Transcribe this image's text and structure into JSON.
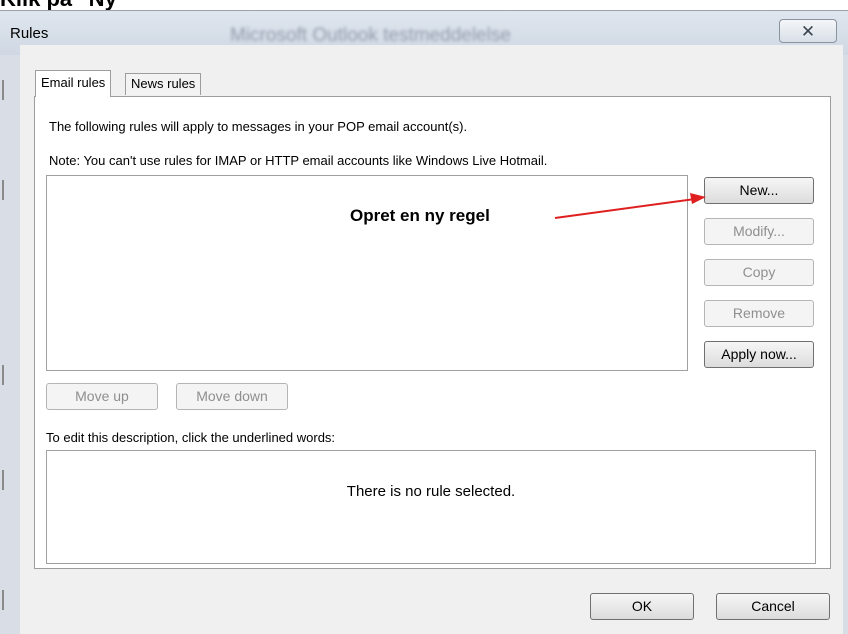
{
  "caption": {
    "text": "Klik på \"Ny\""
  },
  "window": {
    "title": "Rules",
    "background_title": "Microsoft Outlook testmeddelelse",
    "close_symbol": "✕"
  },
  "tabs": [
    {
      "label": "Email rules",
      "active": true
    },
    {
      "label": "News rules",
      "active": false
    }
  ],
  "panel": {
    "info_line": "The following rules will apply to messages in your POP email account(s).",
    "note_line": "Note: You can't use rules for IMAP or HTTP email accounts like Windows Live Hotmail."
  },
  "side_buttons": {
    "new": "New...",
    "modify": "Modify...",
    "copy": "Copy",
    "remove": "Remove",
    "apply_now": "Apply now..."
  },
  "move_buttons": {
    "up": "Move up",
    "down": "Move down"
  },
  "description": {
    "label": "To edit this description, click the underlined words:",
    "empty_text": "There is no rule selected."
  },
  "annotation": {
    "text": "Opret en ny regel",
    "color": "#e02020"
  },
  "footer": {
    "ok": "OK",
    "cancel": "Cancel"
  }
}
